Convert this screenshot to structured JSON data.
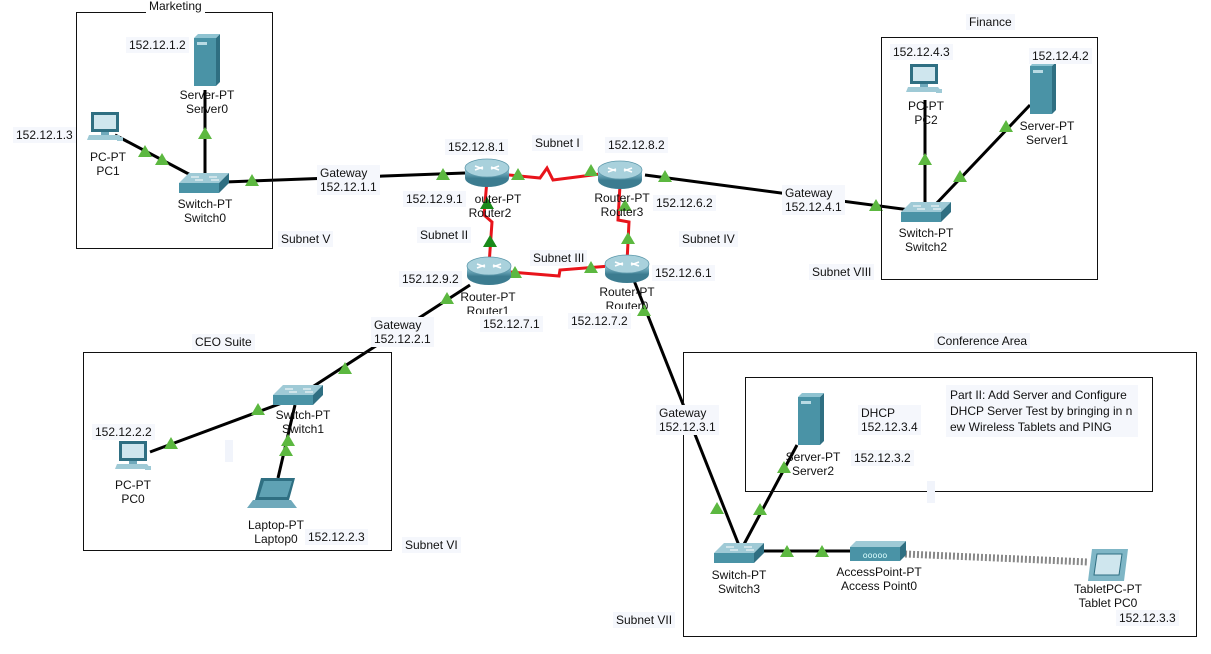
{
  "areas": {
    "marketing": "Marketing",
    "finance": "Finance",
    "ceo": "CEO Suite",
    "conference": "Conference Area"
  },
  "subnets": {
    "s1": "Subnet I",
    "s2": "Subnet II",
    "s3": "Subnet III",
    "s4": "Subnet IV",
    "s5": "Subnet V",
    "s6": "Subnet VI",
    "s7": "Subnet VII",
    "s8": "Subnet VIII"
  },
  "devices": {
    "server0": {
      "type": "Server-PT",
      "name": "Server0",
      "ip": "152.12.1.2"
    },
    "pc1": {
      "type": "PC-PT",
      "name": "PC1",
      "ip": "152.12.1.3"
    },
    "switch0": {
      "type": "Switch-PT",
      "name": "Switch0"
    },
    "router2": {
      "type": "Router-PT",
      "name": "Router2",
      "type_visible": "outer-PT",
      "ip_top": "152.12.8.1",
      "ip_left": "152.12.9.1"
    },
    "router3": {
      "type": "Router-PT",
      "name": "Router3",
      "ip_top": "152.12.8.2",
      "ip_right": "152.12.6.2"
    },
    "router1": {
      "type": "Router-PT",
      "name": "Router1",
      "ip_left": "152.12.9.2",
      "ip_bottom": "152.12.7.1"
    },
    "router0": {
      "type": "Router-PT",
      "name": "Router0",
      "ip_right": "152.12.6.1",
      "ip_bottom": "152.12.7.2"
    },
    "pc2": {
      "type": "PC-PT",
      "name": "PC2",
      "ip": "152.12.4.3"
    },
    "server1": {
      "type": "Server-PT",
      "name": "Server1",
      "ip": "152.12.4.2"
    },
    "switch2": {
      "type": "Switch-PT",
      "name": "Switch2"
    },
    "switch1": {
      "type": "Switch-PT",
      "name": "Switch1"
    },
    "pc0": {
      "type": "PC-PT",
      "name": "PC0",
      "ip": "152.12.2.2"
    },
    "laptop0": {
      "type": "Laptop-PT",
      "name": "Laptop0",
      "ip": "152.12.2.3"
    },
    "server2": {
      "type": "Server-PT",
      "name": "Server2",
      "ip": "152.12.3.2"
    },
    "switch3": {
      "type": "Switch-PT",
      "name": "Switch3"
    },
    "ap0": {
      "type": "AccessPoint-PT",
      "name": "Access Point0"
    },
    "tablet0": {
      "type": "TabletPC-PT",
      "name": "Tablet PC0",
      "ip": "152.12.3.3"
    }
  },
  "gateways": {
    "g1": "Gateway\n152.12.1.1",
    "g4": "Gateway\n152.12.4.1",
    "g2": "Gateway\n152.12.2.1",
    "g3": "Gateway\n152.12.3.1"
  },
  "dhcp": "DHCP\n152.12.3.4",
  "note": "Part II: Add Server and Configure DHCP Server Test by bringing in new Wireless Tablets and PING",
  "colors": {
    "ethernet": "#000000",
    "serial": "#e8141b",
    "link_up": "#5cb840",
    "link_up_dark": "#1a8a1a",
    "device": "#4a93a6"
  }
}
